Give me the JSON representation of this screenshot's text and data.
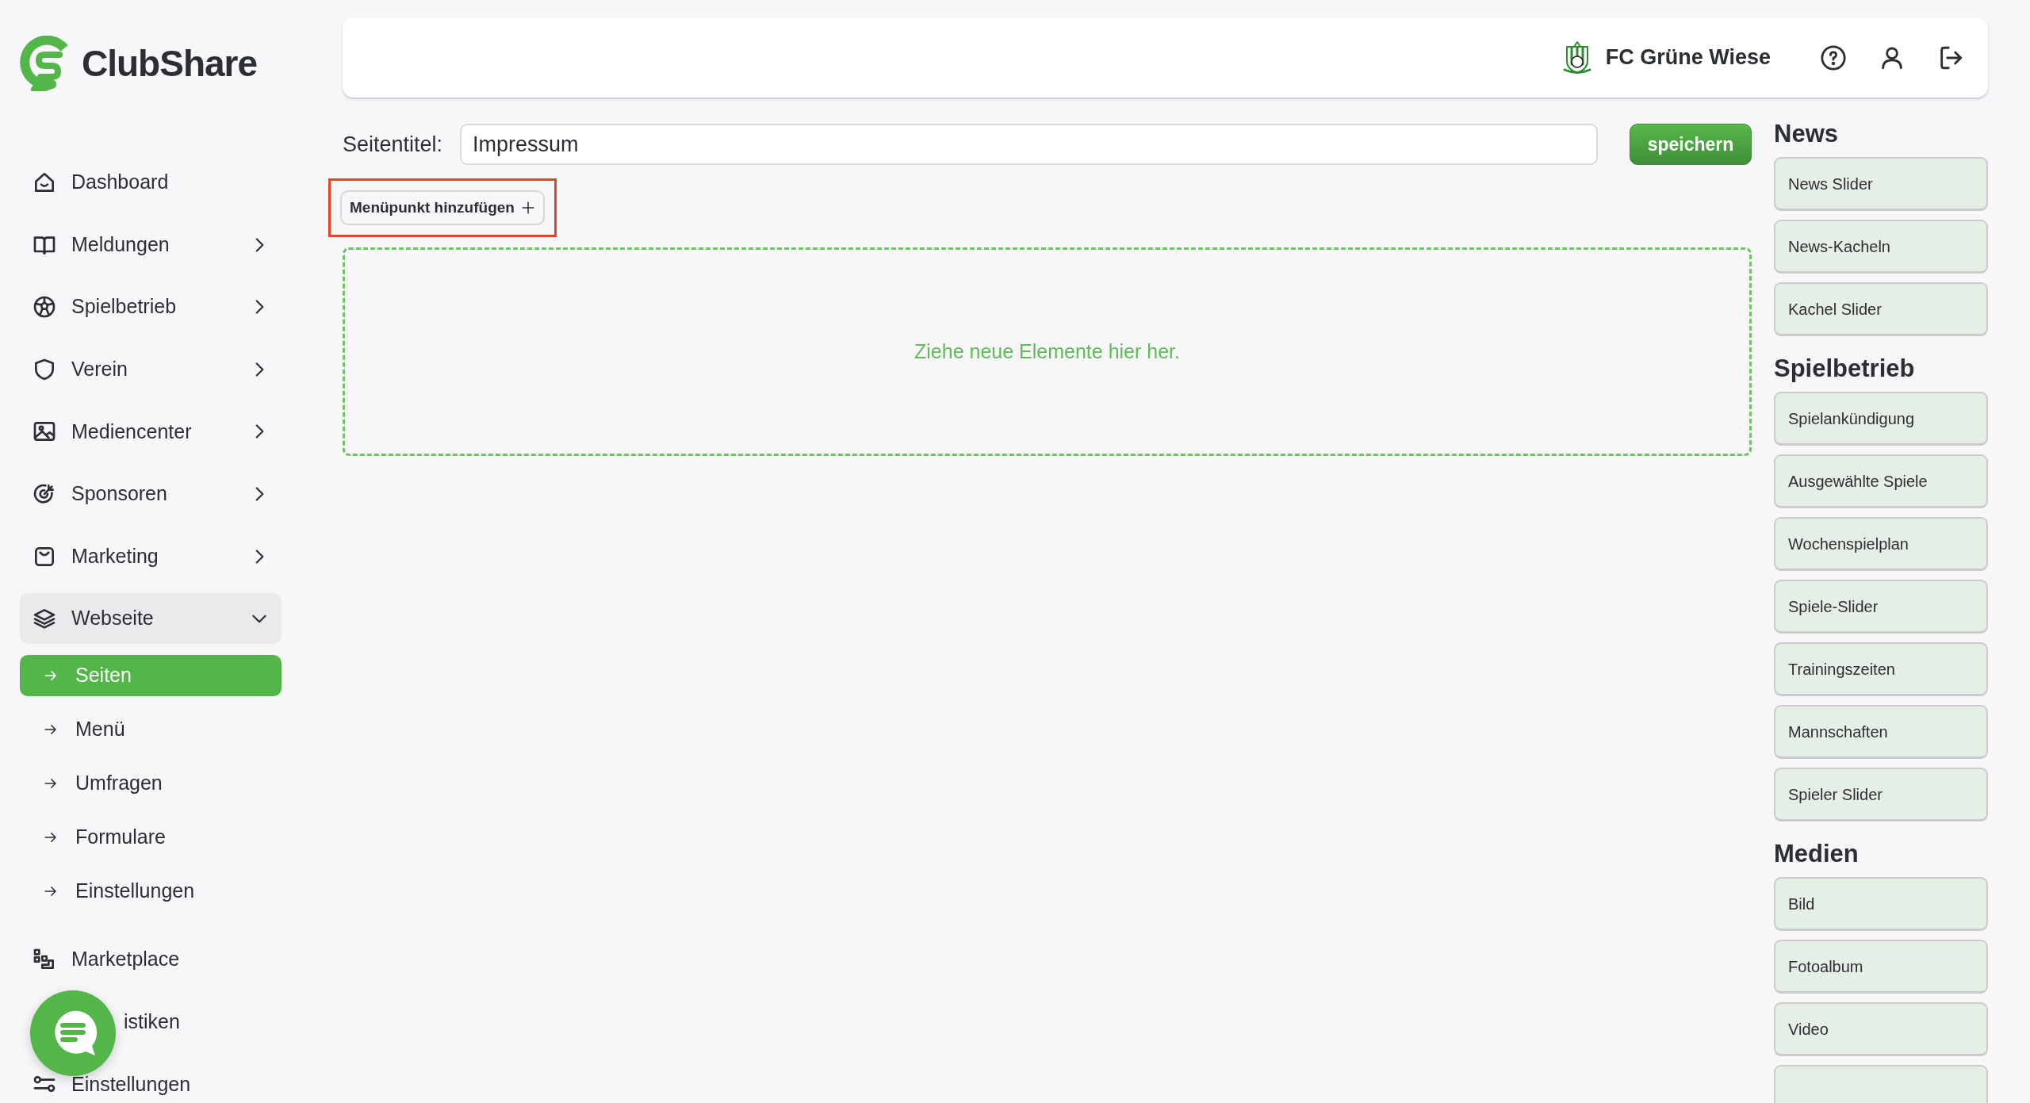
{
  "sidebar": {
    "logo_text": "ClubShare",
    "items": [
      {
        "label": "Dashboard"
      },
      {
        "label": "Meldungen",
        "expanded": false
      },
      {
        "label": "Spielbetrieb",
        "expanded": false
      },
      {
        "label": "Verein",
        "expanded": false
      },
      {
        "label": "Mediencenter",
        "expanded": false
      },
      {
        "label": "Sponsoren",
        "expanded": false
      },
      {
        "label": "Marketing",
        "expanded": false
      },
      {
        "label": "Webseite",
        "expanded": true,
        "children": [
          {
            "label": "Seiten",
            "selected": true
          },
          {
            "label": "Menü",
            "selected": false
          },
          {
            "label": "Umfragen",
            "selected": false
          },
          {
            "label": "Formulare",
            "selected": false
          },
          {
            "label": "Einstellungen",
            "selected": false
          }
        ]
      },
      {
        "label": "Marketplace"
      },
      {
        "label": "istiken"
      },
      {
        "label": "Einstellungen"
      }
    ]
  },
  "header": {
    "club_name": "FC Grüne Wiese"
  },
  "editor": {
    "title_label": "Seitentitel:",
    "title_value": "Impressum",
    "save_button": "speichern",
    "add_menu_item": {
      "label": "Menüpunkt hinzufügen",
      "highlighted": true
    },
    "dropzone_text": "Ziehe neue Elemente hier her."
  },
  "palette": [
    {
      "title": "News",
      "items": [
        {
          "kind": "tile",
          "label": "News Slider"
        },
        {
          "kind": "tile",
          "label": "News-Kacheln"
        },
        {
          "kind": "tile",
          "label": "Kachel Slider"
        }
      ]
    },
    {
      "title": "Spielbetrieb",
      "items": [
        {
          "kind": "tile",
          "label": "Spielankündigung"
        },
        {
          "kind": "tile",
          "label": "Ausgewählte Spiele"
        },
        {
          "kind": "tile",
          "label": "Wochenspielplan"
        },
        {
          "kind": "tile",
          "label": "Spiele-Slider"
        },
        {
          "kind": "tile",
          "label": "Trainingszeiten"
        },
        {
          "kind": "tile",
          "label": "Mannschaften"
        },
        {
          "kind": "tile",
          "label": "Spieler Slider"
        }
      ]
    },
    {
      "title": "Medien",
      "items": [
        {
          "kind": "tile",
          "label": "Bild"
        },
        {
          "kind": "tile",
          "label": "Fotoalbum"
        },
        {
          "kind": "tile",
          "label": "Video"
        },
        {
          "kind": "cut-off"
        }
      ]
    }
  ]
}
